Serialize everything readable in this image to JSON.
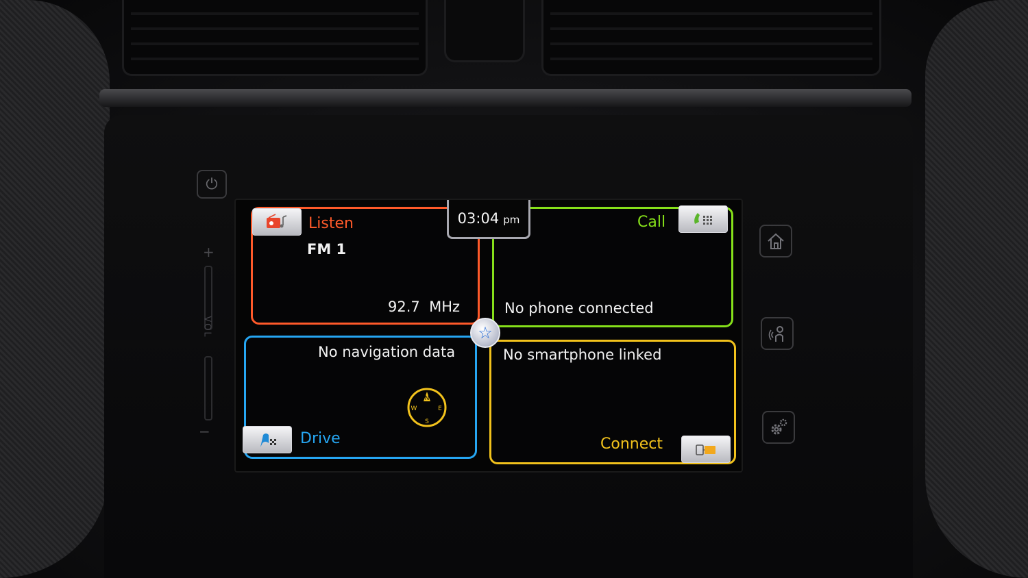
{
  "clock": {
    "time": "03:04",
    "ampm": "pm"
  },
  "tiles": {
    "listen": {
      "label": "Listen",
      "source": "FM 1",
      "frequency": "92.7  MHz",
      "color": "#ff5a2a"
    },
    "call": {
      "label": "Call",
      "status": "No phone connected",
      "color": "#86e01a"
    },
    "drive": {
      "label": "Drive",
      "status": "No navigation data",
      "color": "#26a6f2"
    },
    "connect": {
      "label": "Connect",
      "status": "No smartphone linked",
      "color": "#f2c21c"
    }
  },
  "compass": {
    "north": "N",
    "east": "E",
    "south": "S",
    "west": "W"
  },
  "hardware": {
    "volume_label": "VOL",
    "volume_plus": "+",
    "volume_minus": "−"
  },
  "icons": {
    "listen": "radio-music-icon",
    "call": "phone-keypad-icon",
    "drive": "navigation-flag-icon",
    "connect": "smartphone-link-icon",
    "favorite": "star-icon",
    "power": "power-icon",
    "home": "home-icon",
    "voice": "voice-command-icon",
    "settings": "gear-icon"
  }
}
